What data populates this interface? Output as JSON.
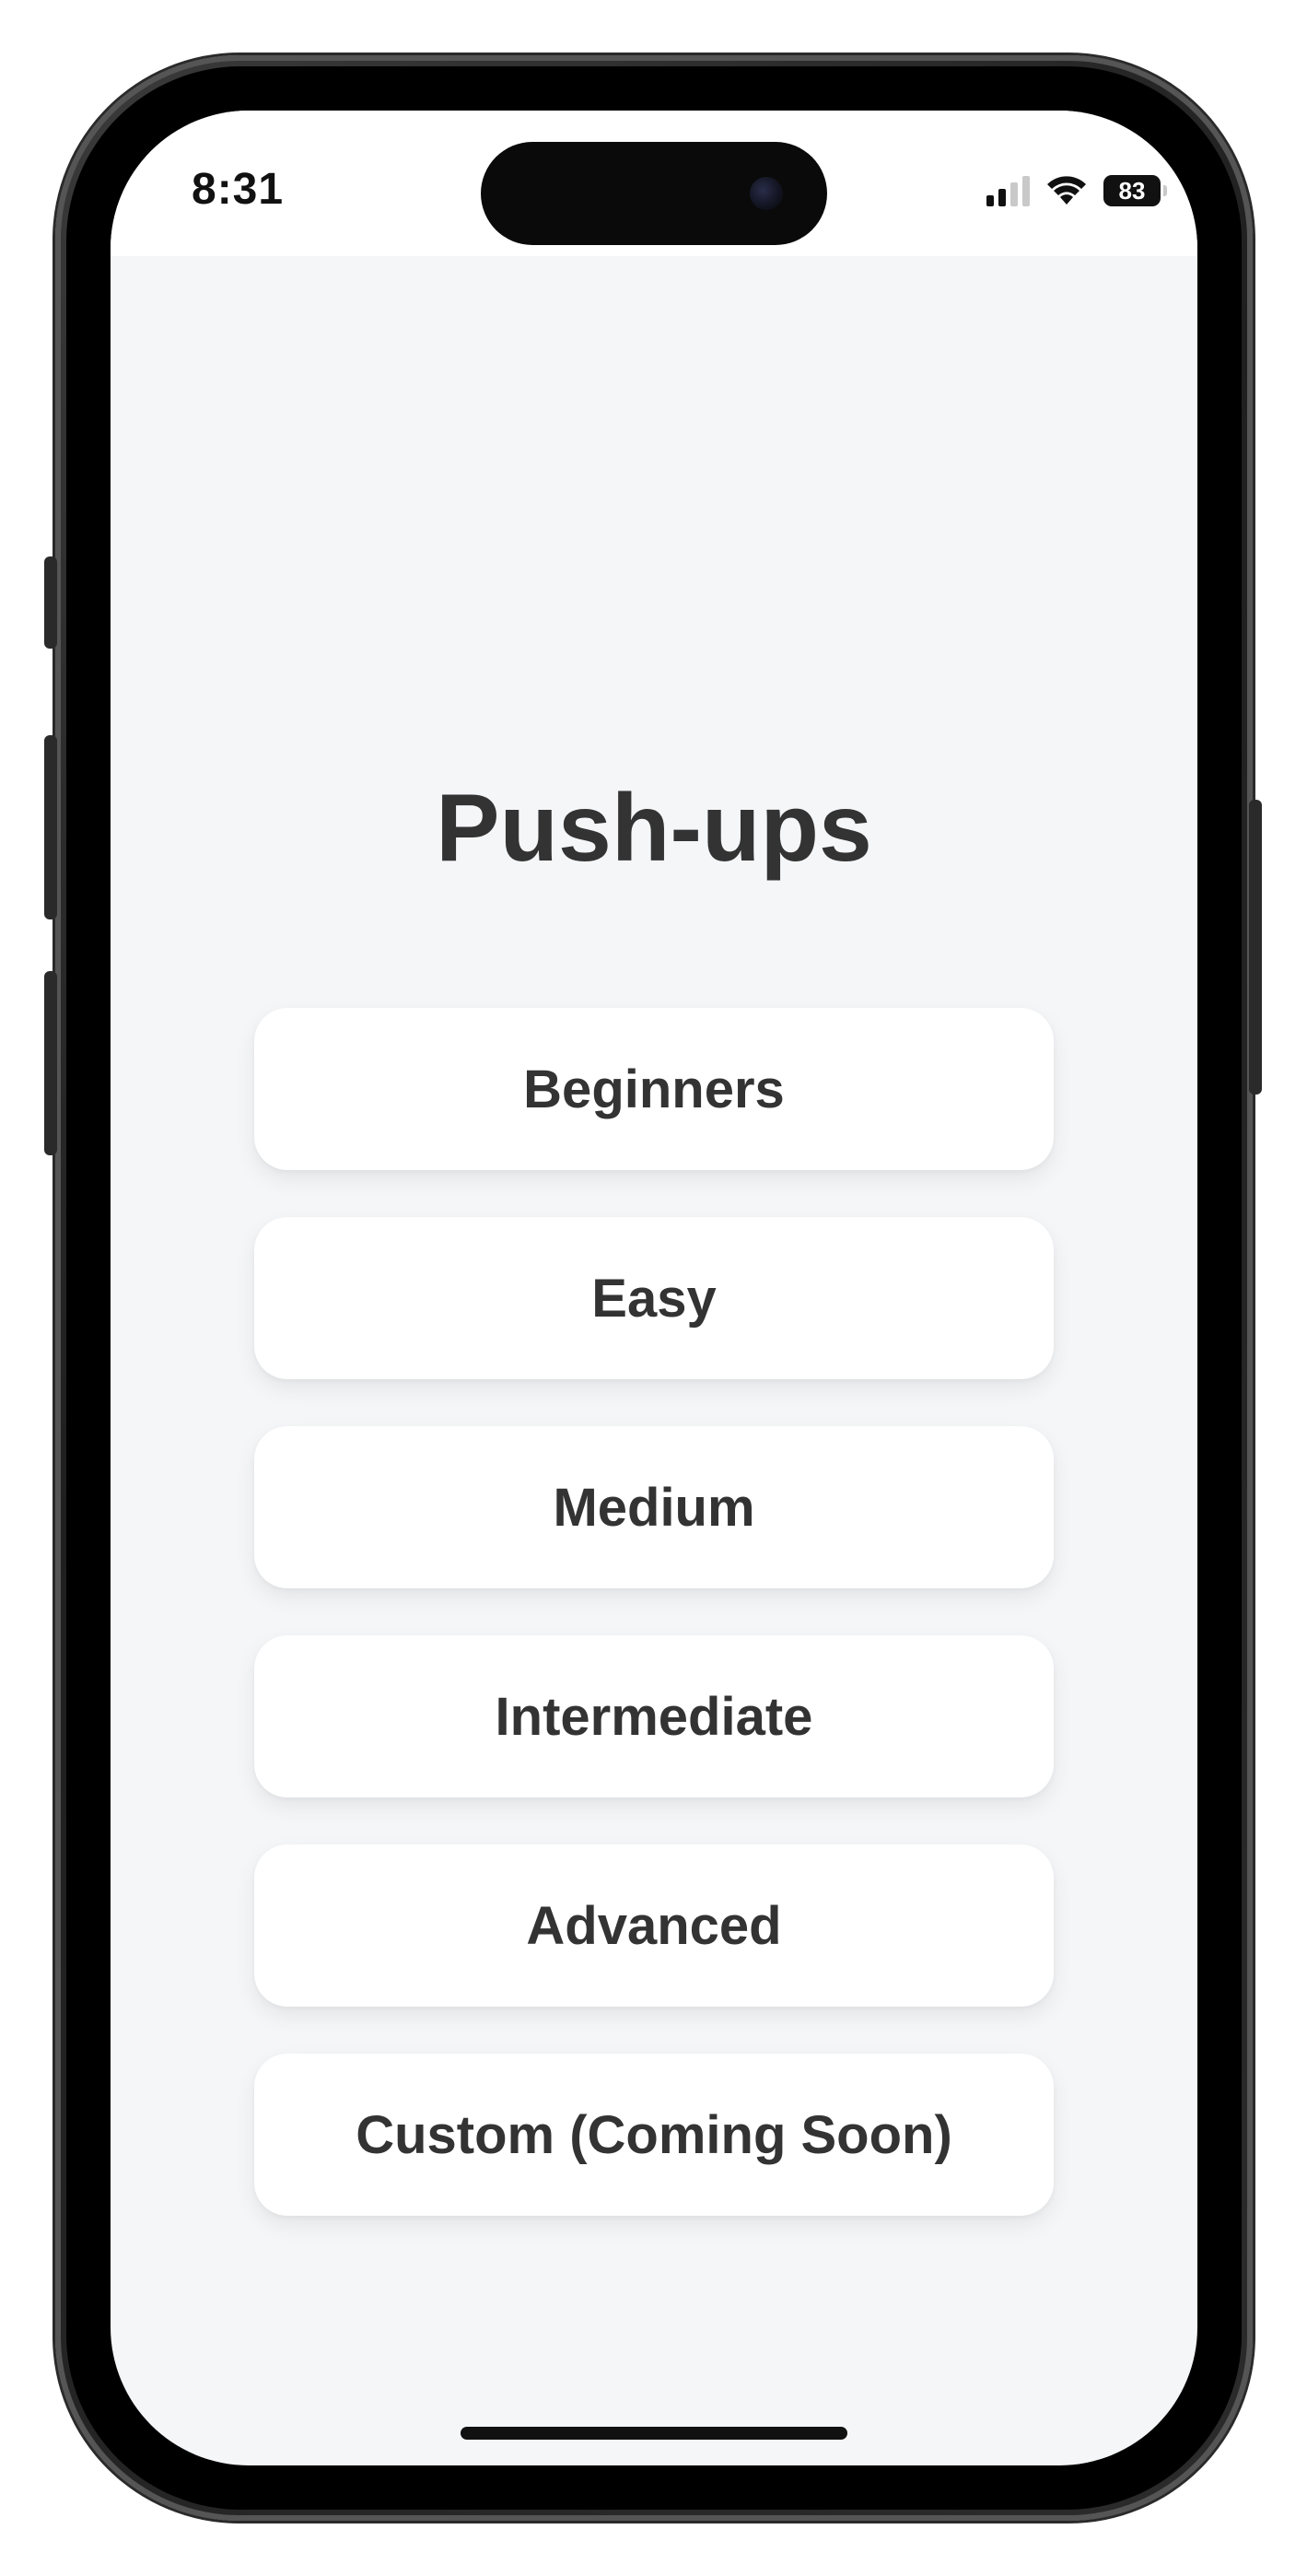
{
  "status_bar": {
    "time": "8:31",
    "battery": "83",
    "icons": [
      "cellular-signal-icon",
      "wifi-icon",
      "battery-icon"
    ]
  },
  "screen": {
    "title": "Push-ups",
    "options": [
      {
        "label": "Beginners"
      },
      {
        "label": "Easy"
      },
      {
        "label": "Medium"
      },
      {
        "label": "Intermediate"
      },
      {
        "label": "Advanced"
      },
      {
        "label": "Custom (Coming Soon)"
      }
    ]
  },
  "colors": {
    "background": "#f5f6f8",
    "card": "#ffffff",
    "text": "#333333"
  }
}
